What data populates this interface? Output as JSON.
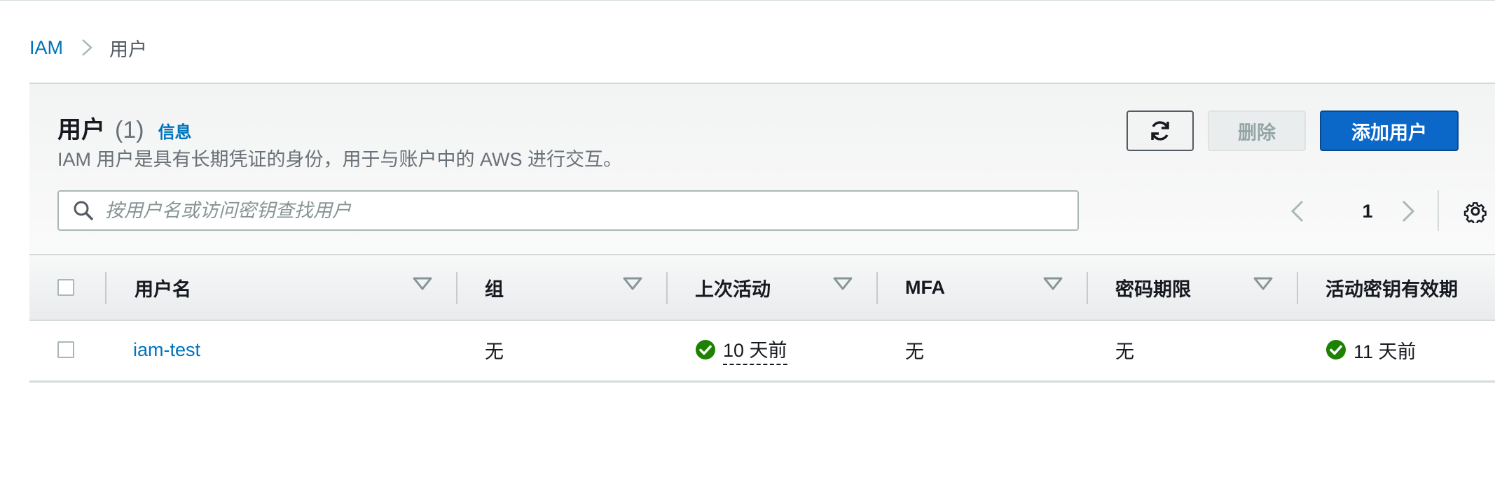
{
  "breadcrumb": {
    "root": "IAM",
    "current": "用户"
  },
  "panel": {
    "title": "用户",
    "count": "(1)",
    "info": "信息",
    "description": "IAM 用户是具有长期凭证的身份，用于与账户中的 AWS 进行交互。"
  },
  "actions": {
    "refresh_icon": "refresh-icon",
    "delete_label": "删除",
    "add_label": "添加用户"
  },
  "search": {
    "placeholder": "按用户名或访问密钥查找用户",
    "value": ""
  },
  "pagination": {
    "current_page": "1"
  },
  "table": {
    "columns": [
      "用户名",
      "组",
      "上次活动",
      "MFA",
      "密码期限",
      "活动密钥有效期"
    ],
    "rows": [
      {
        "username": "iam-test",
        "groups": "无",
        "last_activity": "10 天前",
        "mfa": "无",
        "password_age": "无",
        "active_key_age": "11 天前"
      }
    ]
  },
  "colors": {
    "accent": "#0073bb",
    "primary_button": "#0b68c9",
    "success": "#1d8102",
    "muted_text": "#687078"
  }
}
